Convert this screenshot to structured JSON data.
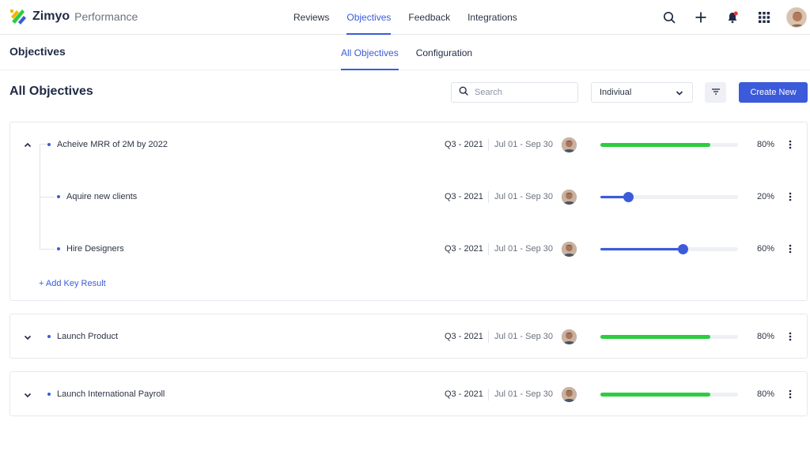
{
  "header": {
    "brand": "Zimyo",
    "product": "Performance",
    "nav": [
      "Reviews",
      "Objectives",
      "Feedback",
      "Integrations"
    ],
    "active_nav": "Objectives",
    "icons": [
      "search-icon",
      "plus-icon",
      "bell-icon",
      "apps-grid-icon",
      "user-avatar"
    ]
  },
  "subheader": {
    "title": "Objectives",
    "tabs": [
      "All Objectives",
      "Configuration"
    ],
    "active_tab": "All Objectives"
  },
  "toolbar": {
    "title": "All Objectives",
    "search_placeholder": "Search",
    "select_value": "Indiviual",
    "create_label": "Create New"
  },
  "objectives": [
    {
      "title": "Acheive MRR of 2M by 2022",
      "quarter": "Q3 - 2021",
      "dates": "Jul 01 - Sep 30",
      "progress": 80,
      "progress_label": "80%",
      "expanded": true,
      "key_results": [
        {
          "title": "Aquire new clients",
          "quarter": "Q3 - 2021",
          "dates": "Jul 01 - Sep 30",
          "progress": 20,
          "progress_label": "20%"
        },
        {
          "title": "Hire Designers",
          "quarter": "Q3 - 2021",
          "dates": "Jul 01 - Sep 30",
          "progress": 60,
          "progress_label": "60%"
        }
      ],
      "add_label": "+ Add Key Result"
    },
    {
      "title": "Launch Product",
      "quarter": "Q3 - 2021",
      "dates": "Jul 01 - Sep 30",
      "progress": 80,
      "progress_label": "80%",
      "expanded": false
    },
    {
      "title": "Launch International Payroll",
      "quarter": "Q3 - 2021",
      "dates": "Jul 01 - Sep 30",
      "progress": 80,
      "progress_label": "80%",
      "expanded": false
    }
  ],
  "colors": {
    "accent": "#3b5bdb",
    "progress_green": "#2ecc40"
  }
}
